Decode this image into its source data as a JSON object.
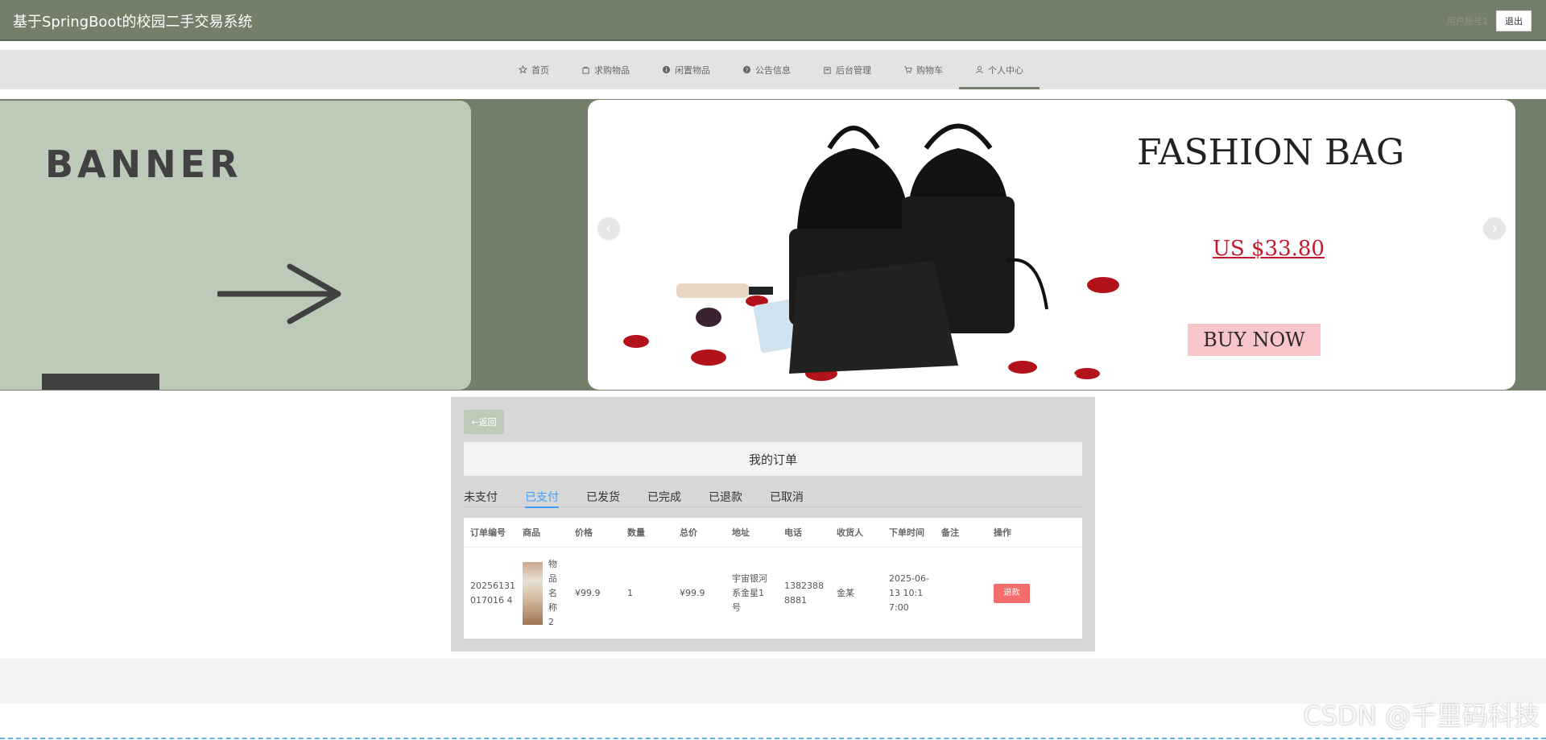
{
  "header": {
    "title": "基于SpringBoot的校园二手交易系统",
    "user_label": "用户账号1",
    "logout_label": "退出"
  },
  "nav": {
    "items": [
      {
        "label": "首页",
        "icon": "star-icon"
      },
      {
        "label": "求购物品",
        "icon": "bag-icon"
      },
      {
        "label": "闲置物品",
        "icon": "info-icon"
      },
      {
        "label": "公告信息",
        "icon": "question-icon"
      },
      {
        "label": "后台管理",
        "icon": "building-icon"
      },
      {
        "label": "购物车",
        "icon": "cart-icon"
      },
      {
        "label": "个人中心",
        "icon": "user-icon"
      }
    ],
    "active_index": 6
  },
  "banner": {
    "left_text": "BANNER",
    "right_title": "FASHION BAG",
    "right_price": "US $33.80",
    "right_cta": "BUY NOW",
    "prev_icon": "chevron-left-icon",
    "next_icon": "chevron-right-icon"
  },
  "orders": {
    "back_label": "返回",
    "title": "我的订单",
    "tabs": [
      "未支付",
      "已支付",
      "已发货",
      "已完成",
      "已退款",
      "已取消"
    ],
    "active_tab": 1,
    "columns": [
      "订单编号",
      "商品",
      "价格",
      "数量",
      "总价",
      "地址",
      "电话",
      "收货人",
      "下单时间",
      "备注",
      "操作"
    ],
    "rows": [
      {
        "order_no": "20256131017016 4",
        "goods_name": "物品名称2",
        "price": "¥99.9",
        "qty": "1",
        "total": "¥99.9",
        "address": "宇宙银河系金星1号",
        "phone": "13823888881",
        "receiver": "金某",
        "time": "2025-06-13 10:17:00",
        "remark": "",
        "action": "退款"
      }
    ]
  },
  "watermark": "CSDN @千里码科技",
  "colors": {
    "primary": "#737f69",
    "banner_left": "#bccbb8",
    "tab_active": "#409eff",
    "refund": "#f56c6c"
  }
}
